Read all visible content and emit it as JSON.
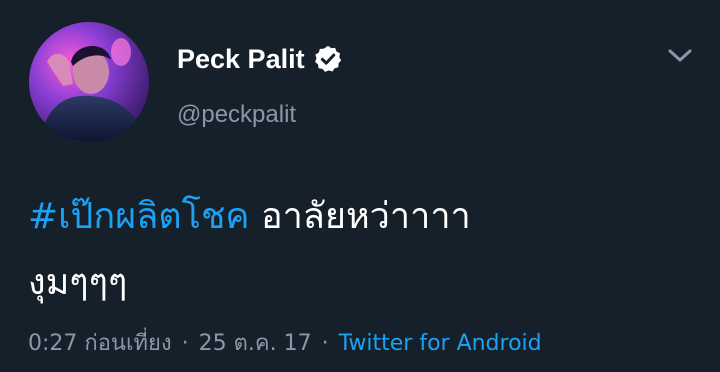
{
  "user": {
    "display_name": "Peck Palit",
    "handle": "@peckpalit",
    "verified": true
  },
  "icons": {
    "verified": "verified-badge-icon",
    "menu": "chevron-down-icon"
  },
  "tweet": {
    "hashtag": "#เป๊กผลิตโชค",
    "text_rest": " อาลัยหว่าาาา",
    "text_line2": "งุมๆๆๆ"
  },
  "meta": {
    "time": "0:27 ก่อนเที่ยง",
    "separator": "·",
    "date": "25 ต.ค. 17",
    "source": "Twitter for Android"
  },
  "colors": {
    "background": "#15202b",
    "link": "#1da1f2",
    "secondary_text": "#8899a6",
    "primary_text": "#ffffff"
  }
}
